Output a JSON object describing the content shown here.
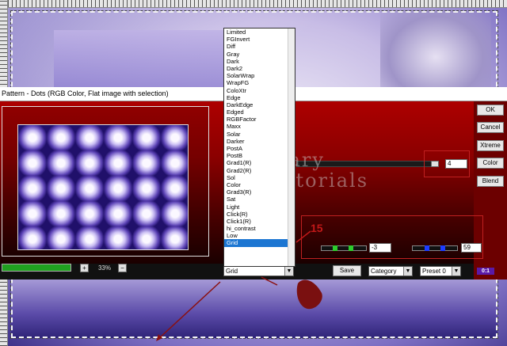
{
  "dialog": {
    "title": "Pattern - Dots (RGB Color, Flat image with selection)",
    "buttons": {
      "ok": "OK",
      "cancel": "Cancel",
      "xtreme": "Xtreme",
      "color": "Color",
      "blend": "Blend"
    },
    "slider_value": "4",
    "slider2_value": "-3",
    "slider3_value": "59",
    "zoom": {
      "minus": "−",
      "plus": "+",
      "value": "33%"
    },
    "mode": {
      "current": "Grid"
    },
    "save_label": "Save",
    "category": "Category",
    "preset": "Preset 0",
    "badge": "0:1"
  },
  "dropdown": {
    "selected": "Grid",
    "items": [
      "Limited",
      "FGInvert",
      "Diff",
      "Gray",
      "Dark",
      "Dark2",
      "SolarWrap",
      "WrapFG",
      "ColoXtr",
      "Edge",
      "DarkEdge",
      "Edged",
      "RGBFactor",
      "Maxx",
      "Solar",
      "Darker",
      "PostA",
      "PostB",
      "Grad1(R)",
      "Grad2(R)",
      "Sol",
      "Color",
      "Grad3(R)",
      "Sat",
      "Light",
      "Click(R)",
      "Click1(R)",
      "hi_contrast",
      "Low",
      "Grid"
    ]
  },
  "watermark": {
    "line1": "Mary",
    "line2": "Tutorials"
  },
  "annotation": {
    "step": "15"
  }
}
